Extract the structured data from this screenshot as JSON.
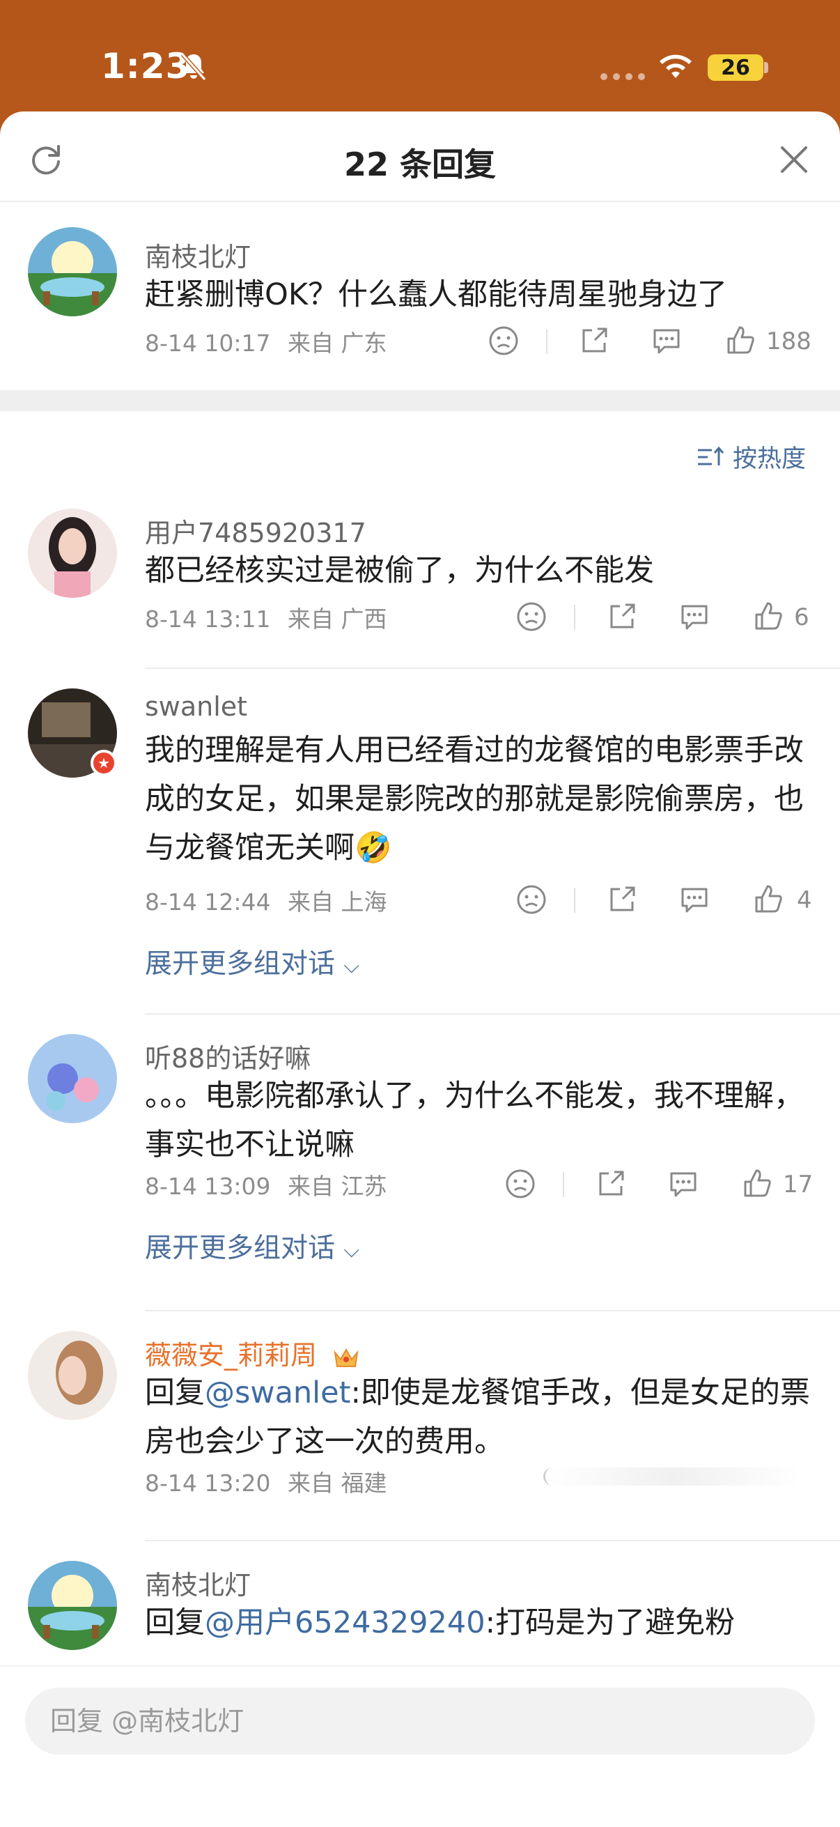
{
  "status_bar": {
    "time": "1:23",
    "battery": "26"
  },
  "sheet": {
    "title": "22 条回复",
    "sort_label": "按热度"
  },
  "main_comment": {
    "username": "南枝北灯",
    "text": "赶紧删博OK？什么蠢人都能待周星驰身边了",
    "date": "8-14 10:17",
    "location": "来自 广东",
    "likes": "188"
  },
  "replies": [
    {
      "username": "用户7485920317",
      "text": "都已经核实过是被偷了，为什么不能发",
      "date": "8-14 13:11",
      "location": "来自 广西",
      "likes": "6"
    },
    {
      "username": "swanlet",
      "text": "我的理解是有人用已经看过的龙餐馆的电影票手改成的女足，如果是影院改的那就是影院偷票房，也与龙餐馆无关啊",
      "emoji": "🤣",
      "date": "8-14 12:44",
      "location": "来自 上海",
      "likes": "4",
      "expand": "展开更多组对话"
    },
    {
      "username": "听88的话好嘛",
      "text": "。。。电影院都承认了，为什么不能发，我不理解，事实也不让说嘛",
      "date": "8-14 13:09",
      "location": "来自 江苏",
      "likes": "17",
      "expand": "展开更多组对话"
    },
    {
      "username": "薇薇安_莉莉周",
      "reply_prefix": "回复",
      "mention": "@swanlet",
      "text": ":即使是龙餐馆手改，但是女足的票房也会少了这一次的费用。",
      "date": "8-14 13:20",
      "location": "来自 福建"
    },
    {
      "username": "南枝北灯",
      "reply_prefix": "回复",
      "mention": "@用户6524329240",
      "text": ":打码是为了避免粉"
    }
  ],
  "input": {
    "placeholder": "回复 @南枝北灯"
  },
  "icons": [
    "refresh-icon",
    "close-icon",
    "dislike-icon",
    "share-icon",
    "comment-icon",
    "like-icon",
    "sort-icon",
    "crown-icon",
    "bell-off-icon",
    "wifi-icon"
  ]
}
